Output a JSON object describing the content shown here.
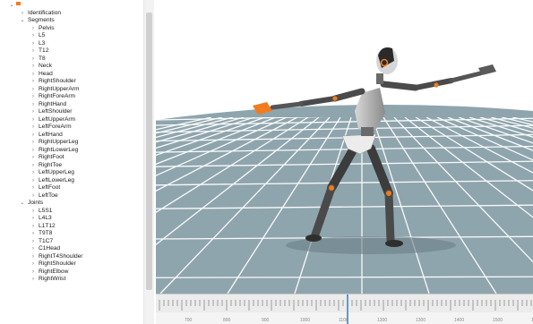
{
  "tree": {
    "identification": "Identification",
    "segments": {
      "label": "Segments",
      "items": [
        "Pelvis",
        "L5",
        "L3",
        "T12",
        "T8",
        "Neck",
        "Head",
        "RightShoulder",
        "RightUpperArm",
        "RightForeArm",
        "RightHand",
        "LeftShoulder",
        "LeftUpperArm",
        "LeftForeArm",
        "LeftHand",
        "RightUpperLeg",
        "RightLowerLeg",
        "RightFoot",
        "RightToe",
        "LeftUpperLeg",
        "LeftLowerLeg",
        "LeftFoot",
        "LeftToe"
      ]
    },
    "joints": {
      "label": "Joints",
      "items": [
        "L5S1",
        "L4L3",
        "L1T12",
        "T9T8",
        "T1C7",
        "C1Head",
        "RightT4Shoulder",
        "RightShoulder",
        "RightElbow",
        "RightWrist"
      ]
    }
  },
  "timeline": {
    "labels": [
      "700",
      "800",
      "900",
      "1000",
      "1100",
      "1200",
      "1300",
      "1400",
      "1500",
      "1600"
    ]
  },
  "colors": {
    "floor": "#8fa5ad",
    "sky": "#ffffff",
    "grid": "#ffffff",
    "accent": "#f07c1e",
    "playhead": "#5b9bd5"
  }
}
